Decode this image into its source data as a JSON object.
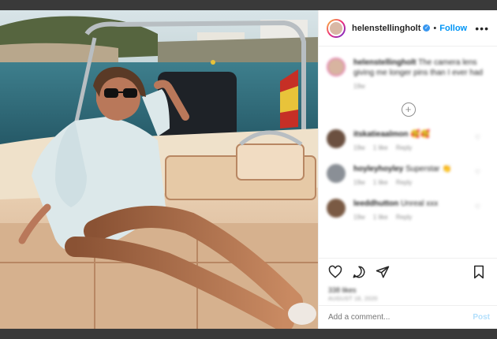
{
  "post": {
    "username": "helenstellingholt",
    "follow_label": "Follow",
    "more_label": "•••"
  },
  "caption": {
    "username": "helenstellingholt",
    "text": "The camera lens giving me longer pins than I ever had",
    "age": "19w"
  },
  "load_more_label": "+",
  "comments": [
    {
      "username": "itskatieaalmon",
      "text": "🥰🥰",
      "age": "19w",
      "likes": "1 like",
      "reply": "Reply"
    },
    {
      "username": "hoyleyhoyley",
      "text": "Superstar 👏",
      "age": "19w",
      "likes": "1 like",
      "reply": "Reply"
    },
    {
      "username": "leeddhutton",
      "text": "Unreal xxx",
      "age": "19w",
      "likes": "1 like",
      "reply": "Reply"
    }
  ],
  "actions": {
    "likes_text": "338 likes",
    "date_text": "AUGUST 18, 2020"
  },
  "add_comment": {
    "placeholder": "Add a comment...",
    "post_label": "Post"
  },
  "colors": {
    "accent": "#0095f6",
    "post_disabled": "#b2dffc",
    "verified": "#3897f0"
  }
}
